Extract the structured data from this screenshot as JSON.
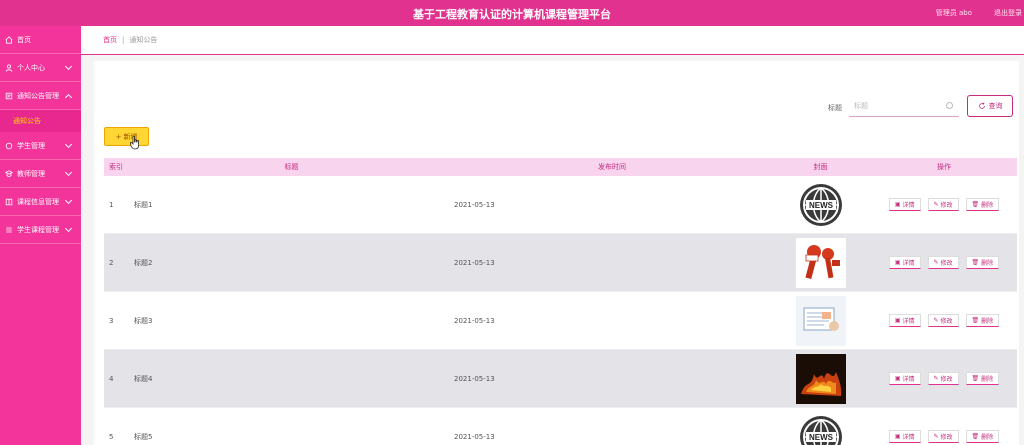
{
  "header": {
    "title": "基于工程教育认证的计算机课程管理平台",
    "user_label": "管理员 abo",
    "logout_label": "退出登录"
  },
  "sidebar": {
    "items": [
      {
        "label": "首页",
        "icon": "home-icon"
      },
      {
        "label": "个人中心",
        "icon": "user-icon"
      },
      {
        "label": "通知公告管理",
        "icon": "bell-icon"
      },
      {
        "label": "学生管理",
        "icon": "student-icon"
      },
      {
        "label": "教师管理",
        "icon": "teacher-icon"
      },
      {
        "label": "课程信息管理",
        "icon": "book-icon"
      },
      {
        "label": "学生课程管理",
        "icon": "list-icon"
      }
    ],
    "sub_item": "通知公告"
  },
  "breadcrumb": {
    "home": "首页",
    "separator": "|",
    "current": "通知公告"
  },
  "search": {
    "label": "标题",
    "placeholder": "标题",
    "button": "查询"
  },
  "add_button": "+ 新增",
  "table": {
    "columns": [
      "索引",
      "标题",
      "发布时间",
      "封面",
      "操作"
    ],
    "actions": {
      "detail": "详情",
      "edit": "修改",
      "delete": "删除"
    },
    "rows": [
      {
        "index": "1",
        "title": "标题1",
        "date": "2021-05-13",
        "cover": "news-globe"
      },
      {
        "index": "2",
        "title": "标题2",
        "date": "2021-05-13",
        "cover": "microphones"
      },
      {
        "index": "3",
        "title": "标题3",
        "date": "2021-05-13",
        "cover": "news-paper"
      },
      {
        "index": "4",
        "title": "标题4",
        "date": "2021-05-13",
        "cover": "fire-text"
      },
      {
        "index": "5",
        "title": "标题5",
        "date": "2021-05-13",
        "cover": "news-globe"
      }
    ]
  },
  "colors": {
    "header": "#e2328f",
    "sidebar": "#f3349a",
    "accent": "#c42a7e",
    "add_button": "#ffd633",
    "table_header": "#f9d4ee"
  }
}
